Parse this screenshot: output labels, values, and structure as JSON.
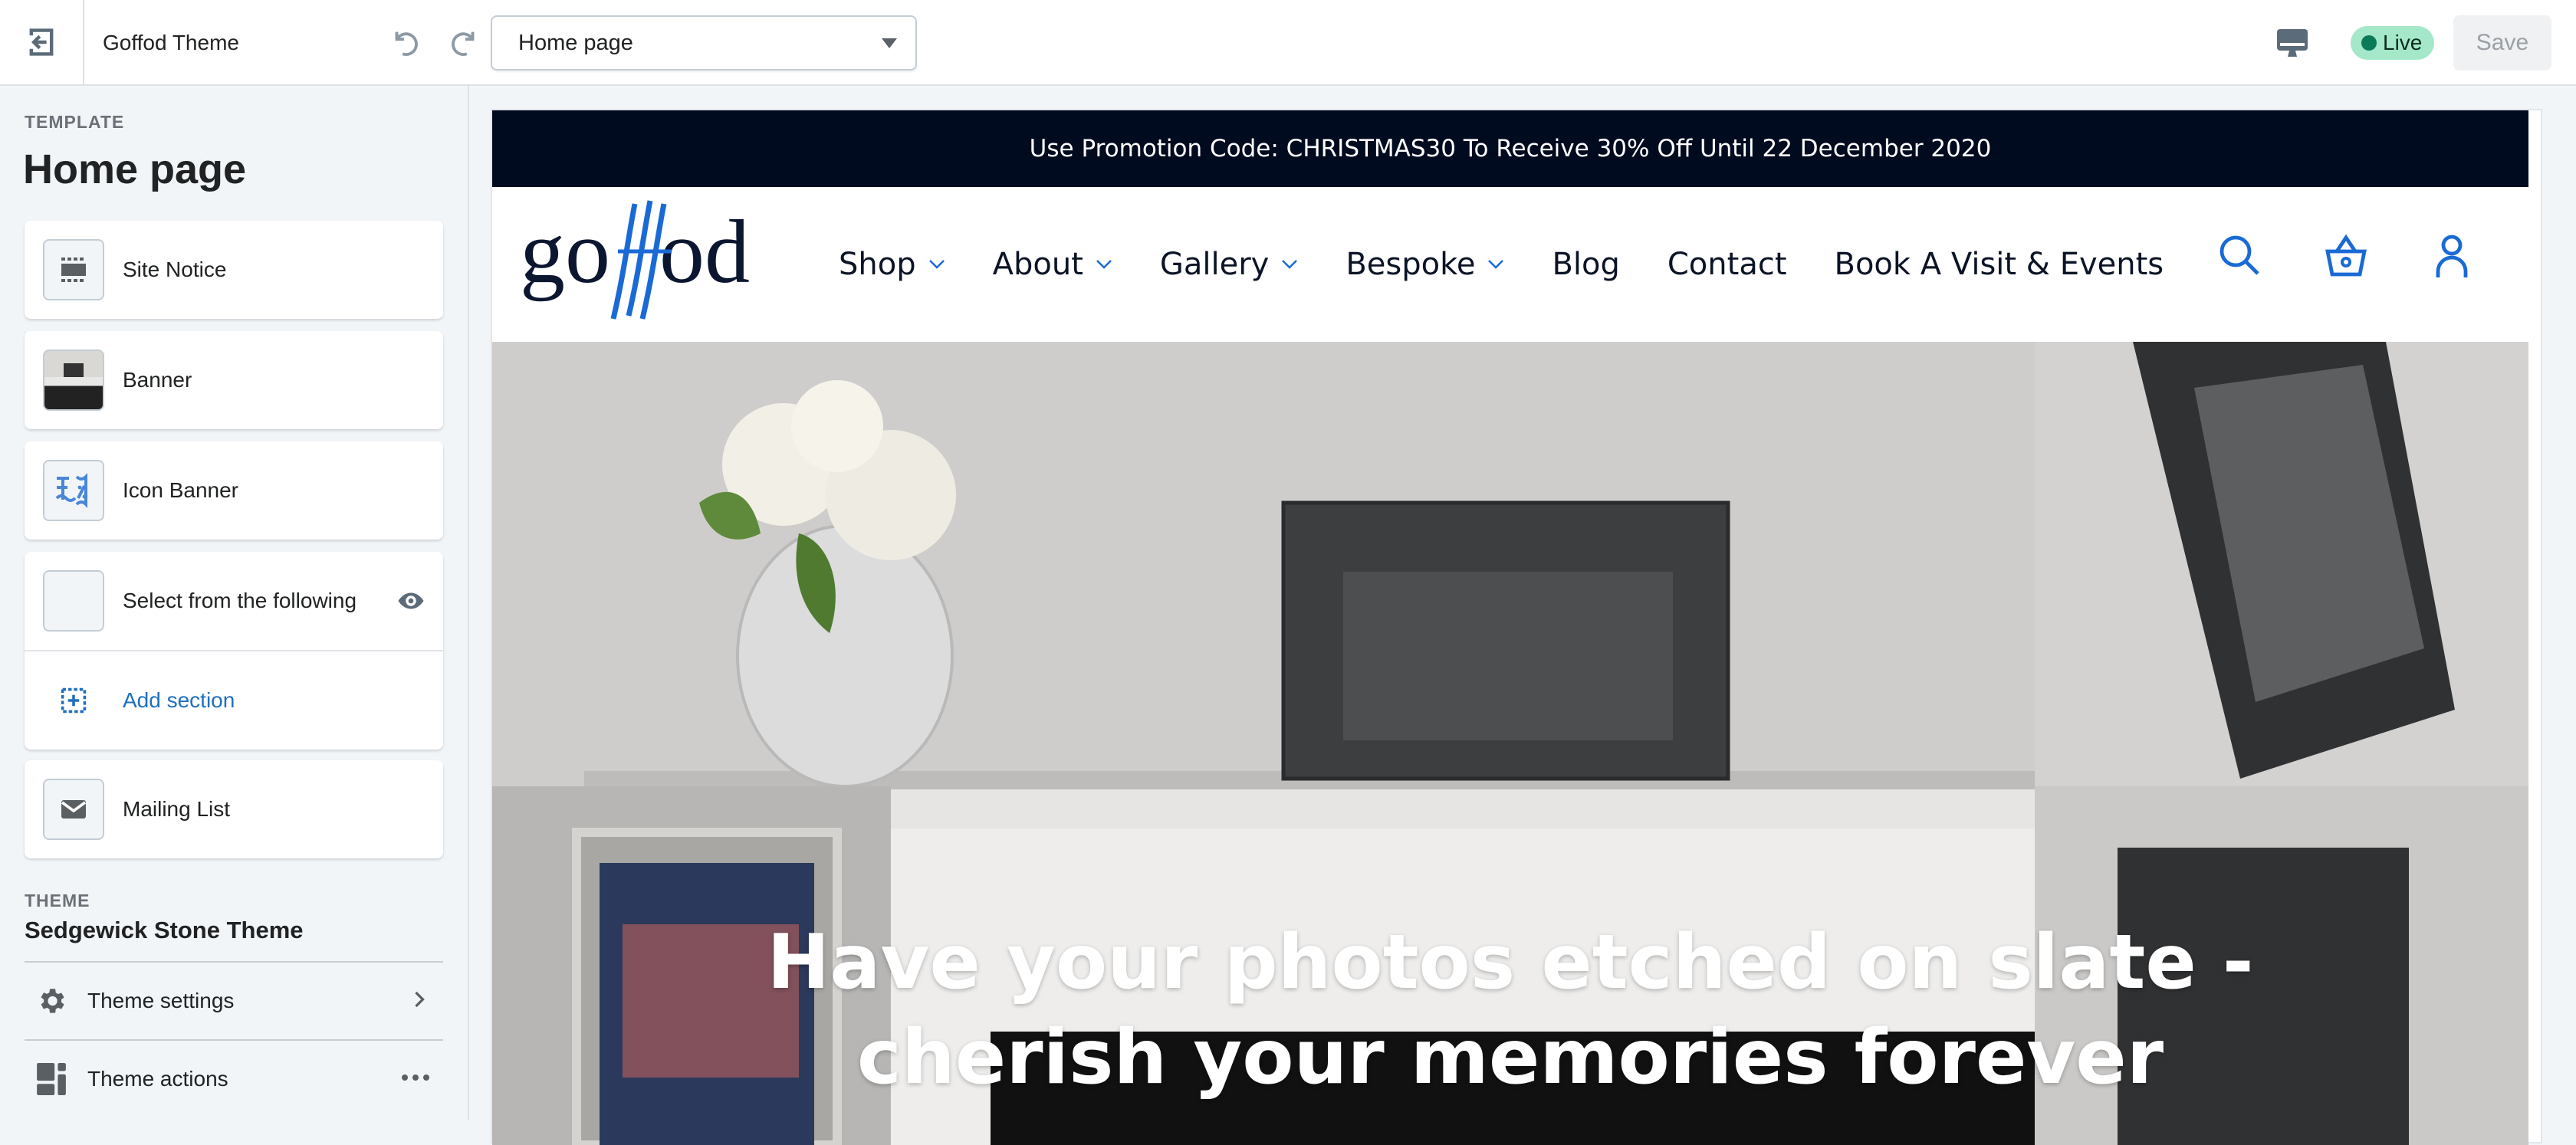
{
  "topbar": {
    "exit_icon": "exit-arrow-icon",
    "theme_name": "Goffod Theme",
    "undo_icon": "undo-icon",
    "redo_icon": "redo-icon",
    "template_select_value": "Home page",
    "device_icon": "desktop-icon",
    "live_label": "Live",
    "live_color": "#a4e8c9",
    "save_label": "Save"
  },
  "sidebar": {
    "template_label": "TEMPLATE",
    "template_title": "Home page",
    "sections": [
      {
        "label": "Site Notice",
        "icon": "site-notice-icon"
      },
      {
        "label": "Banner",
        "icon": "banner-thumbnail"
      },
      {
        "label": "Icon Banner",
        "icon": "icon-banner-icon"
      },
      {
        "label": "Select from the following",
        "icon": "collage-thumbnail",
        "trailing_icon": "eye-icon"
      },
      {
        "label": "Mailing List",
        "icon": "mail-icon"
      }
    ],
    "add_section_label": "Add section",
    "theme_label": "THEME",
    "theme_title": "Sedgewick Stone Theme",
    "theme_settings_label": "Theme settings",
    "theme_actions_label": "Theme actions"
  },
  "preview": {
    "promo_text": "Use Promotion Code: CHRISTMAS30 To Receive 30% Off Until 22 December 2020",
    "logo_text": "goffod",
    "nav": [
      {
        "label": "Shop",
        "dropdown": true
      },
      {
        "label": "About",
        "dropdown": true
      },
      {
        "label": "Gallery",
        "dropdown": true
      },
      {
        "label": "Bespoke",
        "dropdown": true
      },
      {
        "label": "Blog",
        "dropdown": false
      },
      {
        "label": "Contact",
        "dropdown": false
      },
      {
        "label": "Book A Visit & Events",
        "dropdown": false
      }
    ],
    "nav_icons": [
      "search-icon",
      "basket-icon",
      "account-icon"
    ],
    "accent_color": "#1a6ad6",
    "hero_line1": "Have your photos etched on slate -",
    "hero_line2": "cherish your memories forever"
  }
}
